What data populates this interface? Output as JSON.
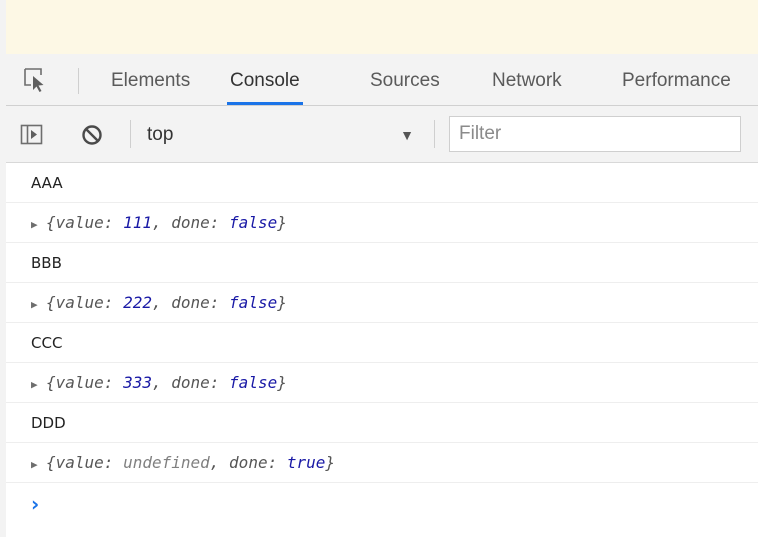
{
  "devtools": {
    "tabs": [
      "Elements",
      "Console",
      "Sources",
      "Network",
      "Performance"
    ],
    "active_tab": "Console",
    "icons": {
      "inspect": "element-picker-icon",
      "sidebar": "show-sidebar-icon",
      "clear": "clear-console-icon",
      "caret": "dropdown-triangle-icon",
      "expand": "expand-triangle-icon",
      "prompt": "console-prompt-chevron-icon"
    },
    "colors": {
      "accent": "#1a73e8",
      "value": "#1a1aa6",
      "prompt": "#1a73e8"
    }
  },
  "toolbar": {
    "context_value": "top",
    "filter_placeholder": "Filter"
  },
  "console": {
    "messages": [
      {
        "type": "text",
        "text": "AAA"
      },
      {
        "type": "object",
        "value": "111",
        "done": "false"
      },
      {
        "type": "text",
        "text": "BBB"
      },
      {
        "type": "object",
        "value": "222",
        "done": "false"
      },
      {
        "type": "text",
        "text": "CCC"
      },
      {
        "type": "object",
        "value": "333",
        "done": "false"
      },
      {
        "type": "text",
        "text": "DDD"
      },
      {
        "type": "object",
        "value": "undefined",
        "done": "true"
      }
    ],
    "syntax": {
      "open": "{",
      "value_key": "value: ",
      "separator": ", ",
      "done_key": "done: ",
      "close": "}"
    },
    "prompt_symbol": "›"
  }
}
